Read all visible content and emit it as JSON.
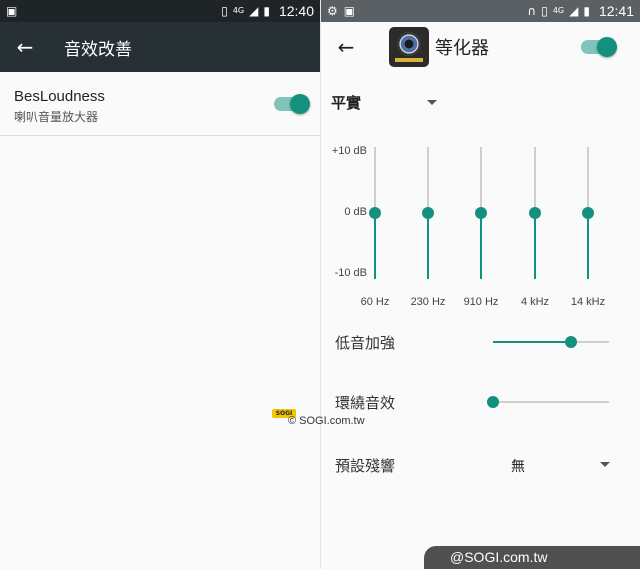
{
  "watermark_left": {
    "badge": "SOGI",
    "text": "© SOGI.com.tw"
  },
  "watermark_corner": "@SOGI.com.tw",
  "left_screen": {
    "status": {
      "time": "12:40",
      "network": "4G",
      "icons": [
        "image-icon",
        "vibrate-icon",
        "signal-icon",
        "battery-icon"
      ]
    },
    "appbar": {
      "title": "音效改善",
      "back_icon": "arrow-left-icon"
    },
    "pref": {
      "title": "BesLoudness",
      "subtitle": "喇叭音量放大器",
      "enabled": true
    }
  },
  "right_screen": {
    "status": {
      "time": "12:41",
      "network": "4G",
      "icons": [
        "settings-icon",
        "image-icon",
        "headphones-icon",
        "vibrate-icon",
        "signal-icon",
        "battery-icon"
      ]
    },
    "appbar": {
      "title": "等化器",
      "back_icon": "arrow-left-icon",
      "app_icon": "speaker-icon",
      "enabled": true
    },
    "preset": {
      "value": "平實"
    },
    "eq": {
      "db_labels": [
        "+10 dB",
        "0 dB",
        "-10 dB"
      ],
      "range_db": [
        -10,
        10
      ],
      "bands": [
        {
          "label": "60 Hz",
          "value_db": 0
        },
        {
          "label": "230 Hz",
          "value_db": 0
        },
        {
          "label": "910 Hz",
          "value_db": 0
        },
        {
          "label": "4 kHz",
          "value_db": 0
        },
        {
          "label": "14 kHz",
          "value_db": 0
        }
      ]
    },
    "bass_boost": {
      "label": "低音加強",
      "level": 0.67
    },
    "virtualizer": {
      "label": "環繞音效",
      "level": 0.0
    },
    "reverb": {
      "label": "預設殘響",
      "value": "無"
    }
  },
  "colors": {
    "accent": "#13917f",
    "accent_light": "#7fc3bb",
    "dark_bar": "#263035"
  }
}
